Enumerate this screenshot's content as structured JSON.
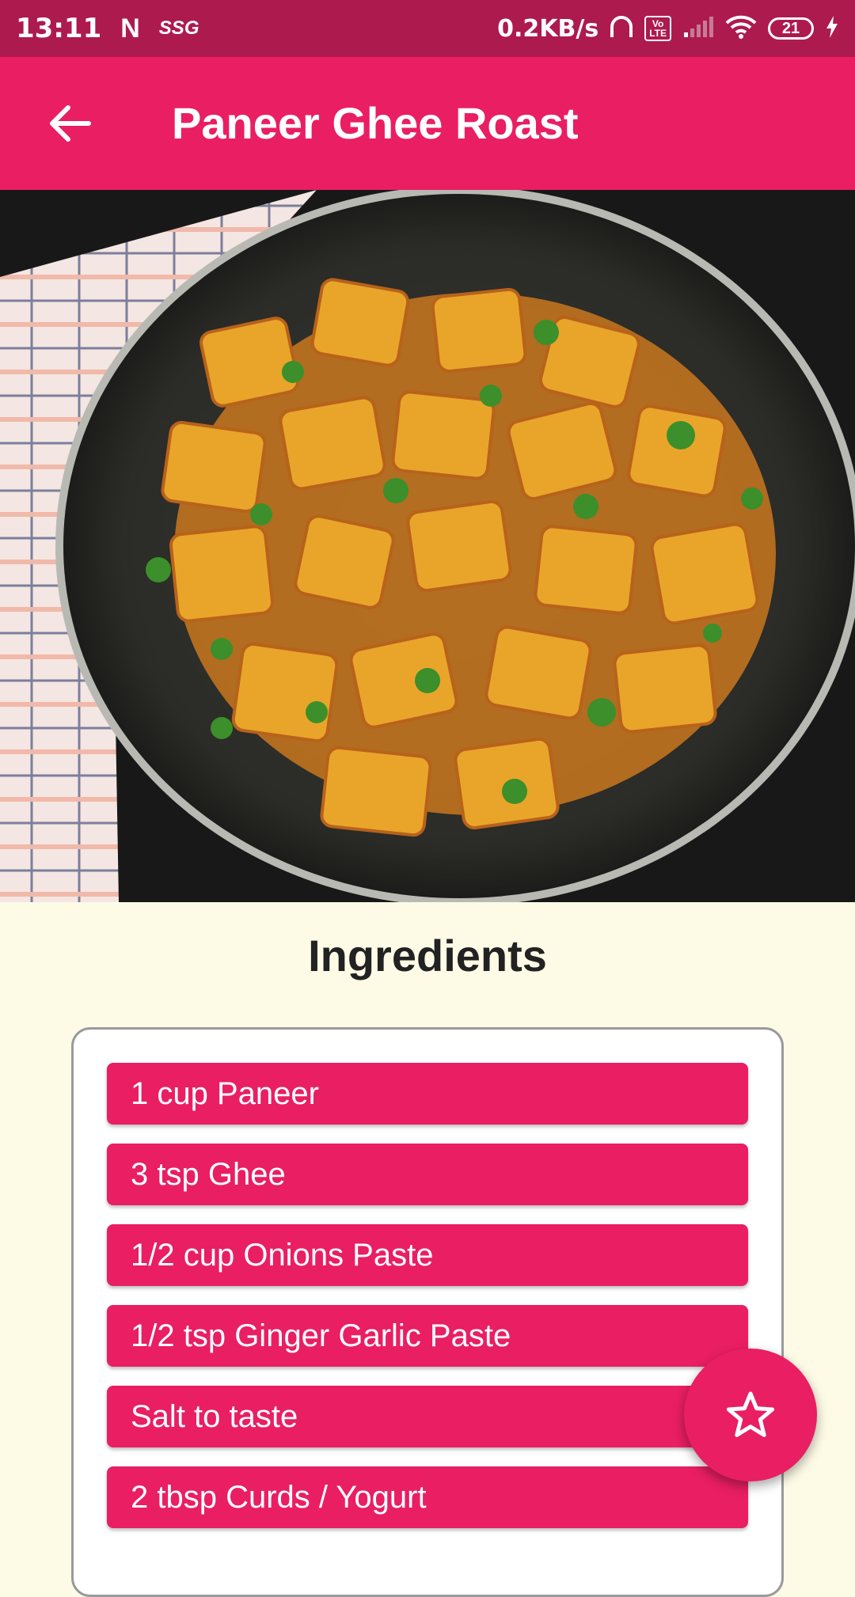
{
  "status_bar": {
    "time": "13:11",
    "n_icon": "N",
    "carrier_label": "SSG",
    "net_speed": "0.2KB/s",
    "volte_top": "Vo",
    "volte_bottom": "LTE",
    "battery": "21",
    "icons": [
      "notification-n-icon",
      "headphones-icon",
      "volte-icon",
      "signal-icon",
      "wifi-icon",
      "battery-icon",
      "charging-icon"
    ]
  },
  "app_bar": {
    "title": "Paneer Ghee Roast",
    "back_icon": "arrow-left-icon"
  },
  "content": {
    "section_title": "Ingredients",
    "ingredients": [
      "1 cup Paneer",
      "3 tsp Ghee",
      "1/2 cup Onions Paste",
      "1/2 tsp Ginger Garlic Paste",
      "Salt to taste",
      "2 tbsp Curds / Yogurt"
    ]
  },
  "fab": {
    "icon": "star-outline-icon"
  },
  "colors": {
    "status_bar": "#ad1a4e",
    "primary": "#e91e63",
    "background": "#fdfbe6",
    "text_dark": "#222222"
  }
}
